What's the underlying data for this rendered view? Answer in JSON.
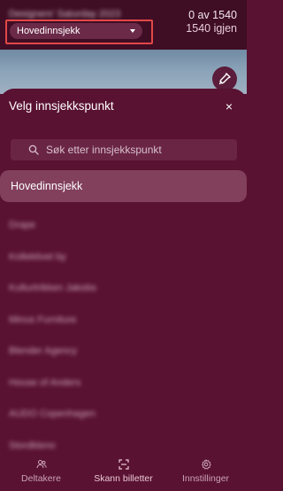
{
  "header": {
    "event_name": "Designers' Saturday 2023",
    "checked_count": "0 av 1540",
    "remaining_count": "1540 igjen",
    "checkpoint_select": {
      "value": "Hovedinnsjekk"
    },
    "highlight_color": "#e24848"
  },
  "torch_icon": "flashlight-icon",
  "sheet": {
    "title": "Velg innsjekkspunkt",
    "close_label": "×",
    "search_placeholder": "Søk etter innsjekkspunkt",
    "selected_item": "Hovedinnsjekk",
    "items": [
      "Drape",
      "Kollektivet by",
      "Kulturtrikken Jakobs",
      "Minus Furniture",
      "Blender Agency",
      "House of Anders",
      "AUDO Copenhagen",
      "Stordkleno"
    ]
  },
  "nav": {
    "tabs": [
      {
        "label": "Deltakere",
        "icon": "participants-icon"
      },
      {
        "label": "Skann billetter",
        "icon": "scan-icon"
      },
      {
        "label": "Innstillinger",
        "icon": "gear-icon"
      }
    ]
  },
  "colors": {
    "background": "#5a1232",
    "header": "#3f0d24",
    "selected_item": "#82405d"
  }
}
